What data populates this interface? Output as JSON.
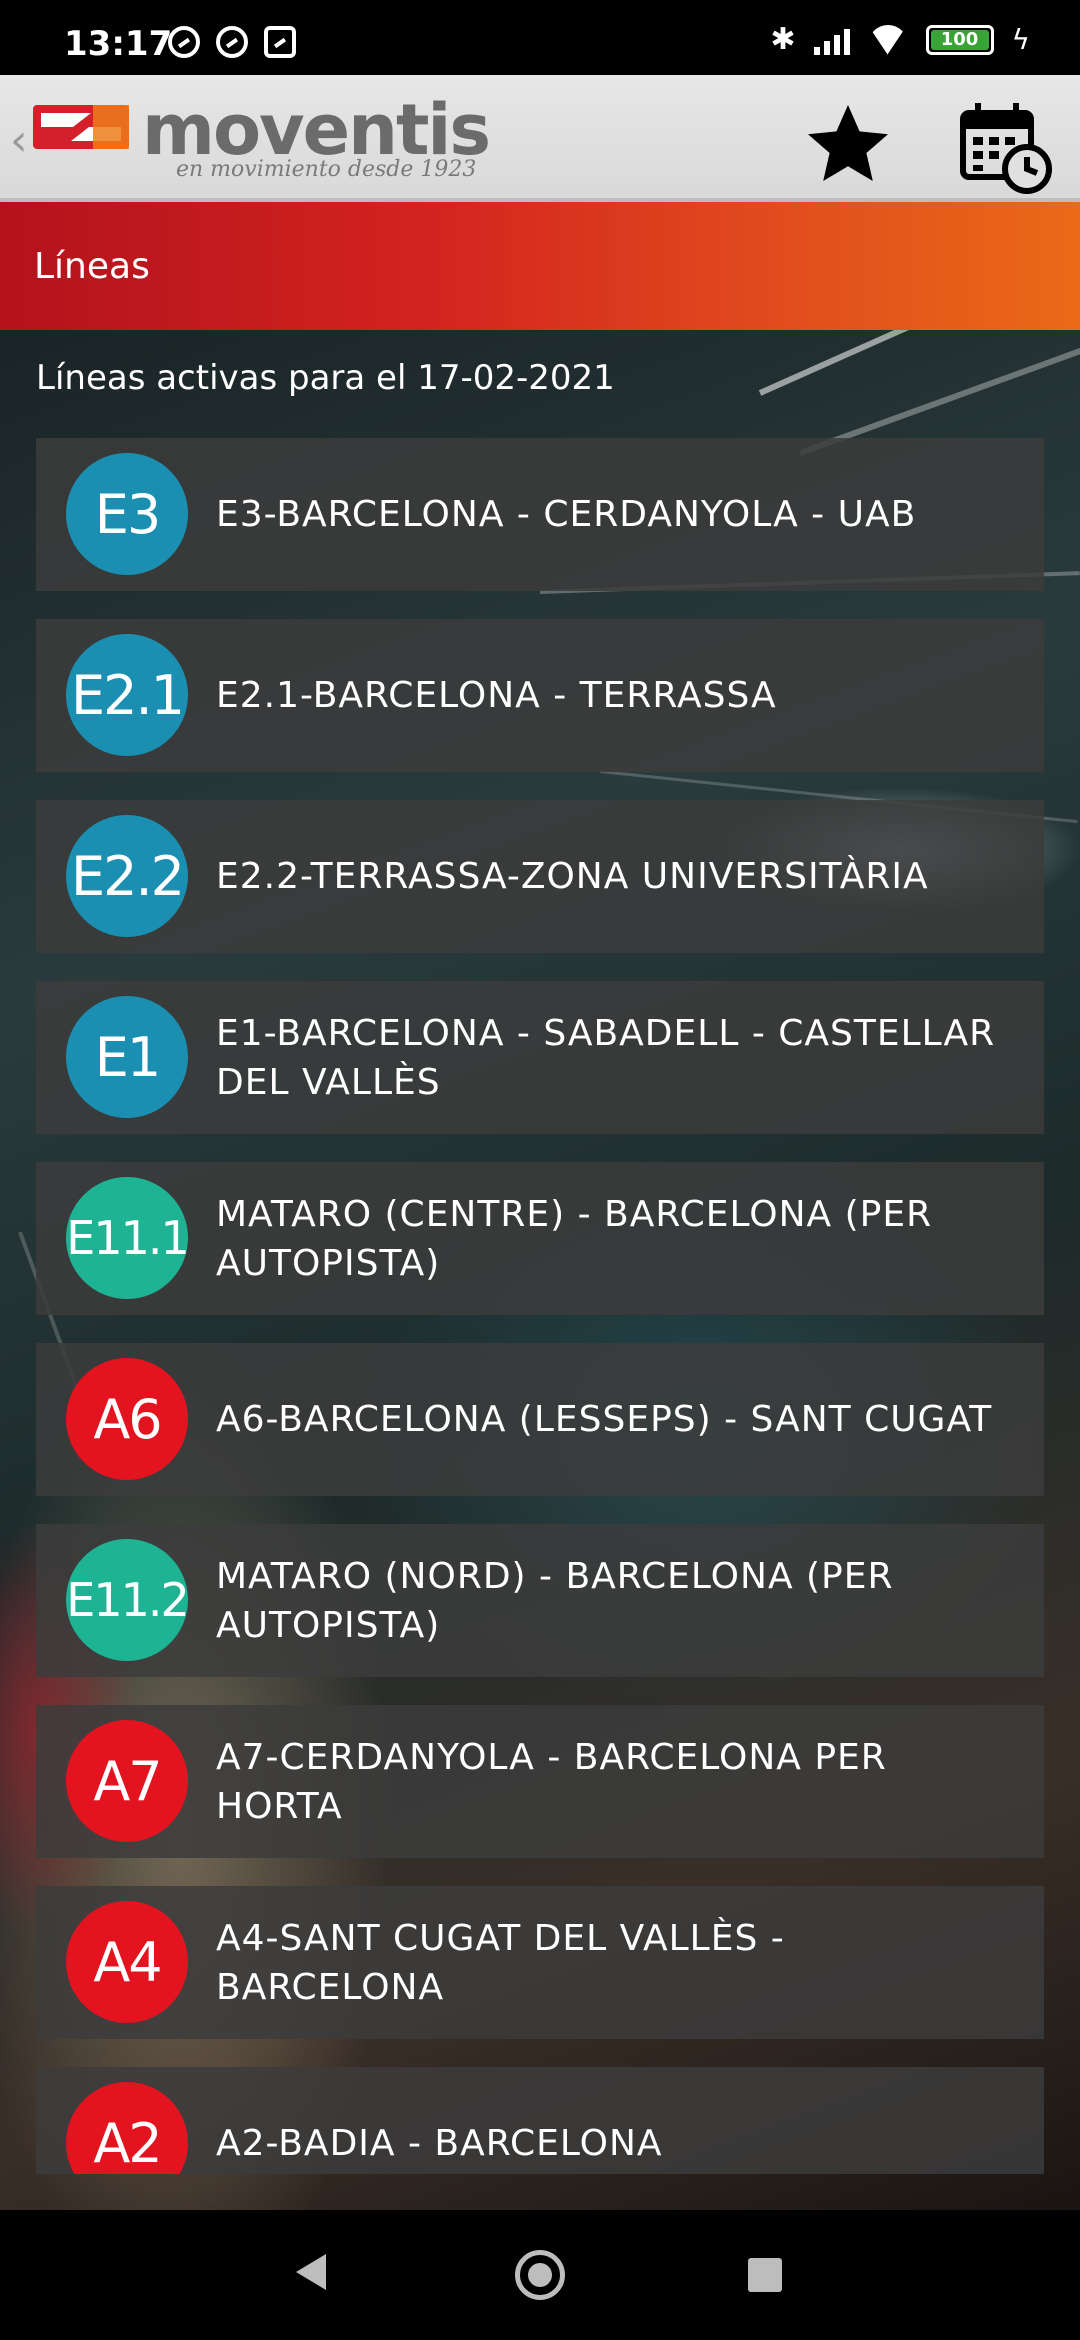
{
  "status_bar": {
    "time": "13:17",
    "battery": "100"
  },
  "header": {
    "brand": "moventis",
    "tagline": "en movimiento desde 1923"
  },
  "section": {
    "title": "Líneas"
  },
  "subtitle": "Líneas activas para el 17-02-2021",
  "colors": {
    "blue_badge": "#1b8fb2",
    "teal_badge": "#1eb493",
    "red_badge": "#e3141f"
  },
  "lines": [
    {
      "code": "E3",
      "name": "E3-BARCELONA - CERDANYOLA - UAB",
      "color": "#1b8fb2"
    },
    {
      "code": "E2.1",
      "name": "E2.1-BARCELONA - TERRASSA",
      "color": "#1b8fb2"
    },
    {
      "code": "E2.2",
      "name": "E2.2-TERRASSA-ZONA UNIVERSITÀRIA",
      "color": "#1b8fb2"
    },
    {
      "code": "E1",
      "name": "E1-BARCELONA - SABADELL - CASTELLAR DEL VALLÈS",
      "color": "#1b8fb2"
    },
    {
      "code": "E11.1",
      "name": "MATARO (CENTRE) - BARCELONA (PER AUTOPISTA)",
      "color": "#1eb493"
    },
    {
      "code": "A6",
      "name": "A6-BARCELONA (LESSEPS) - SANT CUGAT",
      "color": "#e3141f"
    },
    {
      "code": "E11.2",
      "name": "MATARO (NORD) - BARCELONA (PER AUTOPISTA)",
      "color": "#1eb493"
    },
    {
      "code": "A7",
      "name": "A7-CERDANYOLA - BARCELONA PER HORTA",
      "color": "#e3141f"
    },
    {
      "code": "A4",
      "name": "A4-SANT  CUGAT DEL VALLÈS - BARCELONA",
      "color": "#e3141f"
    },
    {
      "code": "A2",
      "name": "A2-BADIA - BARCELONA",
      "color": "#e3141f"
    }
  ]
}
